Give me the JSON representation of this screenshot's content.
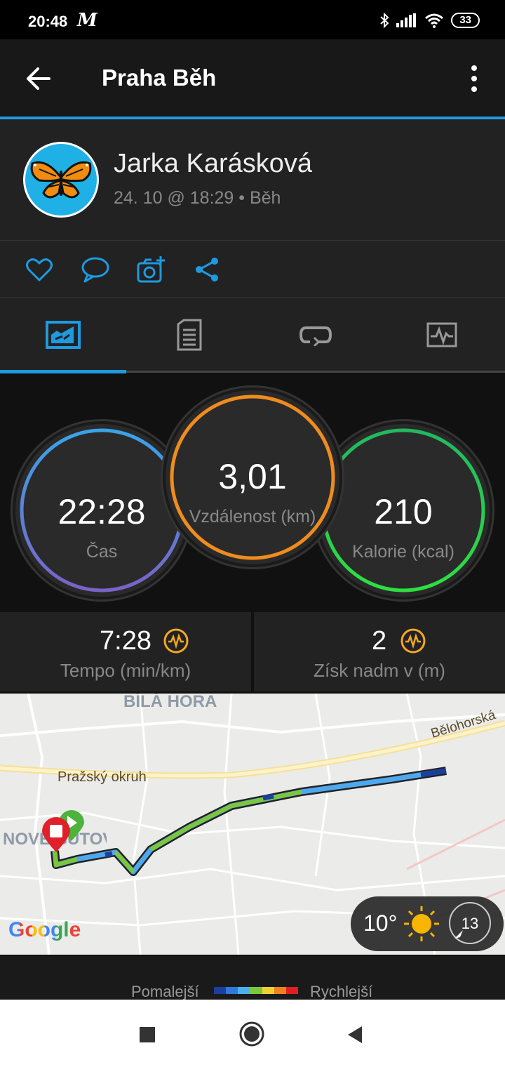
{
  "status": {
    "time": "20:48",
    "carrier_logo": "M",
    "battery": "33",
    "icons": [
      "bluetooth-icon",
      "signal-icon",
      "wifi-icon",
      "battery-icon"
    ]
  },
  "appbar": {
    "title": "Praha Běh"
  },
  "profile": {
    "name": "Jarka Karásková",
    "meta": "24. 10 @ 18:29 • Běh"
  },
  "actions": [
    "like-icon",
    "comment-icon",
    "add-photo-icon",
    "share-icon"
  ],
  "tabs": [
    "tab-overview",
    "tab-details",
    "tab-laps",
    "tab-charts"
  ],
  "stats": {
    "time": {
      "value": "22:28",
      "label": "Čas"
    },
    "distance": {
      "value": "3,01",
      "label": "Vzdálenost (km)"
    },
    "calories": {
      "value": "210",
      "label": "Kalorie (kcal)"
    }
  },
  "substats": {
    "pace": {
      "value": "7:28",
      "label": "Tempo (min/km)"
    },
    "elevation": {
      "value": "2",
      "label": "Získ nadm v (m)"
    }
  },
  "map": {
    "labels": {
      "district_top": "BÍLÁ HORA",
      "district_left": "NOVÉ BUTOVICE",
      "road_left": "Pražský okruh",
      "road_right": "Bělohorská"
    },
    "google_logo": "Google",
    "weather": {
      "temperature": "10°",
      "wind": "13"
    }
  },
  "legend": {
    "slower": "Pomalejší",
    "faster": "Rychlejší",
    "colors": [
      "#1a3f9e",
      "#2f79d9",
      "#4bb0f0",
      "#7cc63c",
      "#f0d030",
      "#f08020",
      "#e02020"
    ]
  },
  "colors": {
    "accent": "#1e9ae0",
    "time_ring": "#4a9ee8",
    "distance_ring": "#f08c1e",
    "calories_ring": "#2fd35c"
  }
}
